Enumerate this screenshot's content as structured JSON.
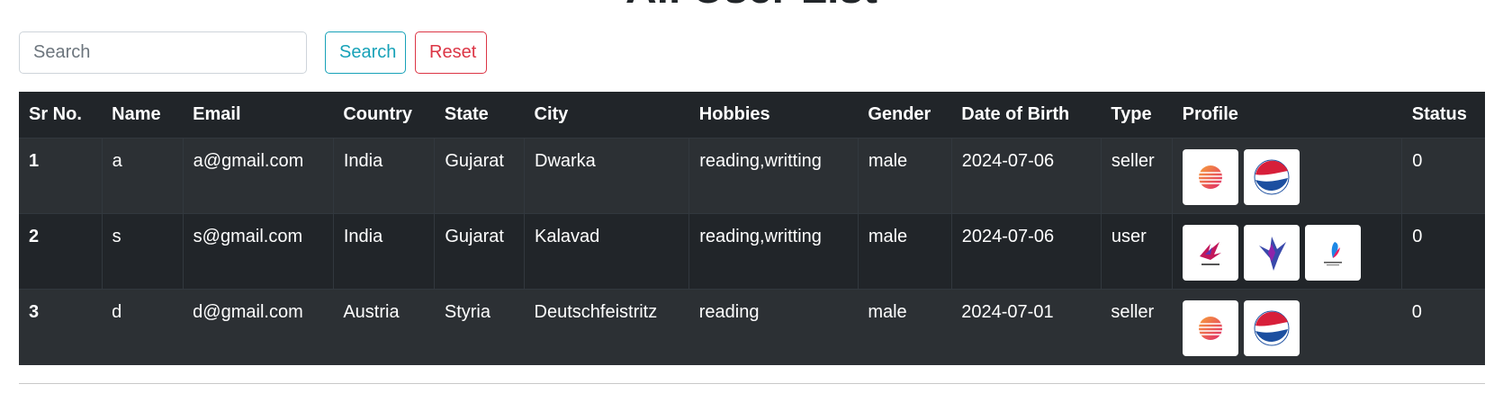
{
  "page": {
    "title": "All User List"
  },
  "search": {
    "placeholder": "Search",
    "value": "",
    "search_label": "Search",
    "reset_label": "Reset"
  },
  "table": {
    "headers": [
      "Sr No.",
      "Name",
      "Email",
      "Country",
      "State",
      "City",
      "Hobbies",
      "Gender",
      "Date of Birth",
      "Type",
      "Profile",
      "Status"
    ],
    "rows": [
      {
        "sr": "1",
        "name": "a",
        "email": "a@gmail.com",
        "country": "India",
        "state": "Gujarat",
        "city": "Dwarka",
        "hobbies": "reading,writting",
        "gender": "male",
        "dob": "2024-07-06",
        "type": "seller",
        "profiles": [
          "sphere-logo-icon",
          "pepsi-logo-icon"
        ],
        "status": "0"
      },
      {
        "sr": "2",
        "name": "s",
        "email": "s@gmail.com",
        "country": "India",
        "state": "Gujarat",
        "city": "Kalavad",
        "hobbies": "reading,writting",
        "gender": "male",
        "dob": "2024-07-06",
        "type": "user",
        "profiles": [
          "bird-logo-icon",
          "hummingbird-logo-icon",
          "feather-logo-icon"
        ],
        "status": "0"
      },
      {
        "sr": "3",
        "name": "d",
        "email": "d@gmail.com",
        "country": "Austria",
        "state": "Styria",
        "city": "Deutschfeistritz",
        "hobbies": "reading",
        "gender": "male",
        "dob": "2024-07-01",
        "type": "seller",
        "profiles": [
          "sphere-logo-icon",
          "pepsi-logo-icon"
        ],
        "status": "0"
      }
    ]
  },
  "colors": {
    "table_header_bg": "#212529",
    "row_odd_bg": "#2c3034",
    "search_button": "#17a2b8",
    "reset_button": "#dc3545"
  }
}
